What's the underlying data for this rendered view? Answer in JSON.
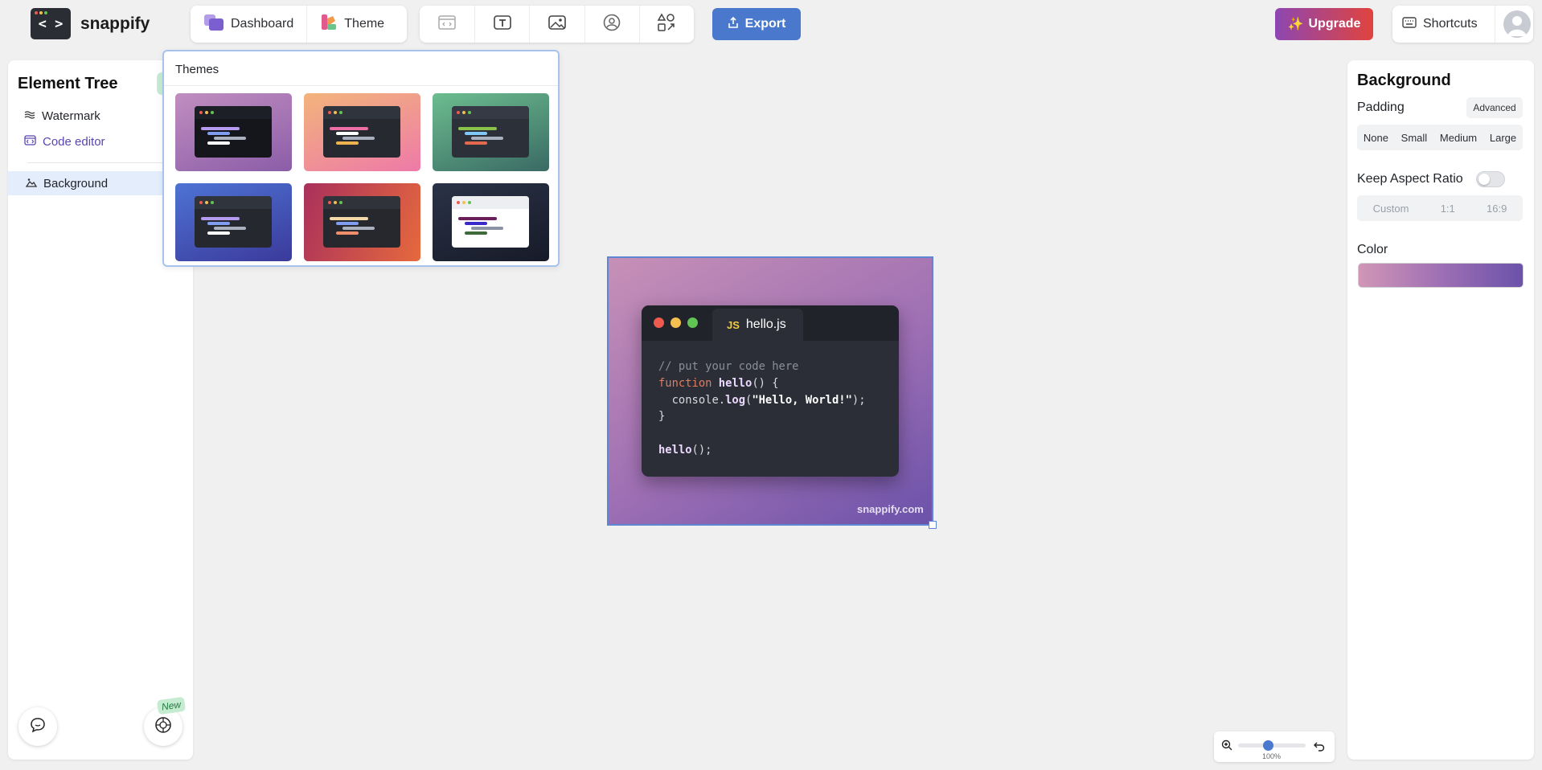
{
  "app": {
    "name": "snappify",
    "logo_glyph": "< >"
  },
  "topbar": {
    "dashboard_label": "Dashboard",
    "theme_label": "Theme",
    "tools": [
      "window-icon",
      "text-icon",
      "image-icon",
      "avatar-icon",
      "shapes-icon"
    ],
    "export_label": "Export",
    "upgrade_label": "Upgrade",
    "upgrade_glyph": "✨",
    "shortcuts_label": "Shortcuts"
  },
  "element_tree": {
    "title": "Element Tree",
    "items": [
      {
        "label": "Watermark",
        "icon": "waves-icon"
      },
      {
        "label": "Code editor",
        "icon": "code-window-icon"
      },
      {
        "label": "Background",
        "icon": "landscape-icon",
        "selected": true
      }
    ],
    "new_badge": "New"
  },
  "themes_popup": {
    "title": "Themes",
    "themes": [
      {
        "bg": "linear-gradient(160deg,#c18ec0,#8b5da8)",
        "win": "#14161b",
        "bar": "#1c1f25",
        "lines": [
          "#b59cf0",
          "#7f9cf0",
          "#a9b1c0",
          "#ffffff"
        ]
      },
      {
        "bg": "linear-gradient(160deg,#f2b47b,#ee7aa8)",
        "win": "#262930",
        "bar": "#30343c",
        "lines": [
          "#ee6ea5",
          "#ffffff",
          "#a9b1c0",
          "#f0b24e"
        ]
      },
      {
        "bg": "linear-gradient(160deg,#6cbd8f,#3a6a64)",
        "win": "#2b3039",
        "bar": "#353a44",
        "lines": [
          "#8bc34a",
          "#7fc8f8",
          "#a9b1c0",
          "#e2694d"
        ]
      },
      {
        "bg": "linear-gradient(160deg,#4d73d4,#3b3a9b)",
        "win": "#25282f",
        "bar": "#30343c",
        "lines": [
          "#b59cf0",
          "#7f9cf0",
          "#a9b1c0",
          "#ffffff"
        ]
      },
      {
        "bg": "linear-gradient(110deg,#a9305c,#e6693d)",
        "win": "#26282d",
        "bar": "#30333a",
        "lines": [
          "#f5d9a8",
          "#7f9cf0",
          "#a9b1c0",
          "#f38e6b"
        ]
      },
      {
        "bg": "linear-gradient(160deg,#2a3247,#171b28)",
        "win": "#ffffff",
        "bar": "#eceef2",
        "lines": [
          "#6b1f5a",
          "#3a2bc9",
          "#8a94a6",
          "#3f6b3a"
        ]
      }
    ]
  },
  "canvas": {
    "filename": "hello.js",
    "file_badge": "JS",
    "code_lines": [
      {
        "tokens": [
          {
            "t": "// put your code here",
            "c": "tk-cm"
          }
        ]
      },
      {
        "tokens": [
          {
            "t": "function",
            "c": "tk-kw"
          },
          {
            "t": " "
          },
          {
            "t": "hello",
            "c": "tk-fn"
          },
          {
            "t": "() {"
          }
        ]
      },
      {
        "tokens": [
          {
            "t": "  console."
          },
          {
            "t": "log",
            "c": "tk-fn"
          },
          {
            "t": "("
          },
          {
            "t": "\"Hello, World!\"",
            "c": "tk-str"
          },
          {
            "t": ");"
          }
        ]
      },
      {
        "tokens": [
          {
            "t": "}"
          }
        ]
      },
      {
        "tokens": [
          {
            "t": ""
          }
        ]
      },
      {
        "tokens": [
          {
            "t": "hello",
            "c": "tk-fn"
          },
          {
            "t": "();"
          }
        ]
      }
    ],
    "watermark": "snappify.com"
  },
  "zoom": {
    "value": 0.45,
    "label": "100%"
  },
  "background_panel": {
    "title": "Background",
    "padding_label": "Padding",
    "advanced_label": "Advanced",
    "padding_options": [
      "None",
      "Small",
      "Medium",
      "Large"
    ],
    "aspect_label": "Keep Aspect Ratio",
    "aspect_enabled": false,
    "aspect_options": [
      "Custom",
      "1:1",
      "16:9"
    ],
    "color_label": "Color",
    "color_value": "linear-gradient(90deg,#d196b6,#9e6fb4,#6b52aa)"
  },
  "colors": {
    "accent": "#4a78cc",
    "selected_row": "#e3edfb",
    "canvas_border": "#5f86d3"
  }
}
